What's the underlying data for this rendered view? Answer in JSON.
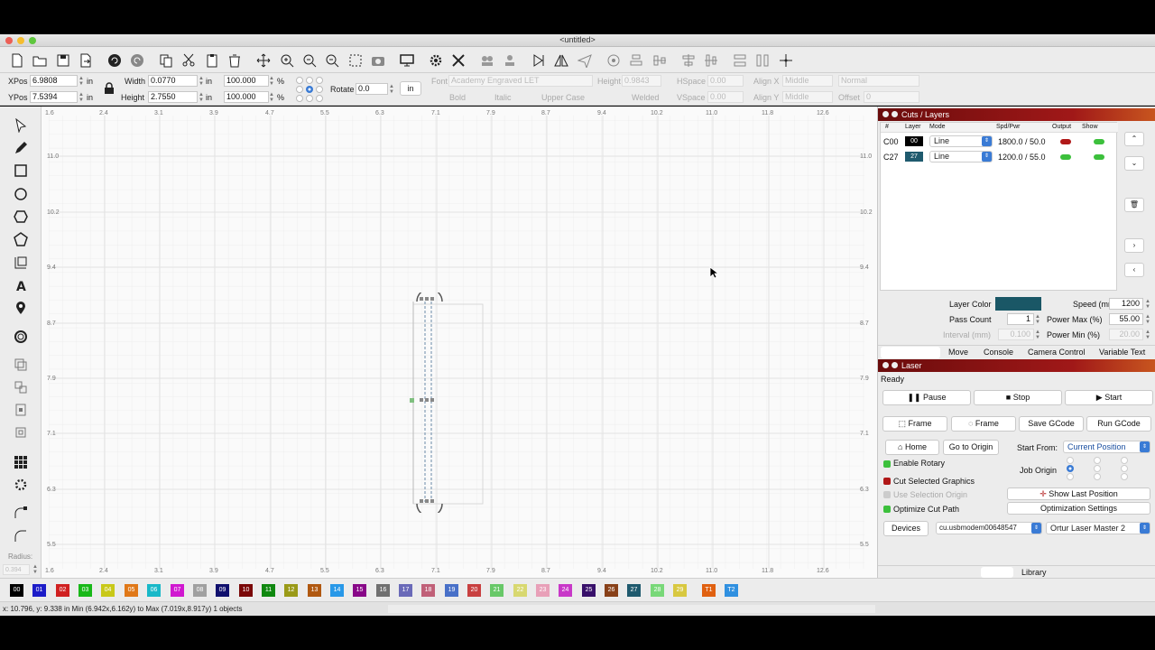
{
  "window": {
    "title": "<untitled>"
  },
  "props": {
    "xpos_label": "XPos",
    "xpos_value": "6.9808",
    "xpos_unit": "in",
    "ypos_label": "YPos",
    "ypos_value": "7.5394",
    "ypos_unit": "in",
    "width_label": "Width",
    "width_value": "0.0770",
    "width_unit": "in",
    "height_label": "Height",
    "height_value": "2.7550",
    "height_unit": "in",
    "scale_x": "100.000",
    "scale_y": "100.000",
    "pct": "%",
    "rotate_label": "Rotate",
    "rotate_value": "0.0",
    "units_button": "in",
    "font_label": "Font",
    "font_value": "Academy Engraved LET",
    "text_height_label": "Height",
    "text_height_value": "0.9843",
    "hspace_label": "HSpace",
    "hspace_value": "0.00",
    "vspace_label": "VSpace",
    "vspace_value": "0.00",
    "alignx_label": "Align X",
    "alignx_value": "Middle",
    "aligny_label": "Align Y",
    "aligny_value": "Middle",
    "style_value": "Normal",
    "offset_label": "Offset",
    "offset_value": "0",
    "bold": "Bold",
    "italic": "Italic",
    "upper_case": "Upper Case",
    "welded": "Welded"
  },
  "ruler": {
    "top": [
      "1.6",
      "2.4",
      "3.1",
      "3.9",
      "4.7",
      "5.5",
      "6.3",
      "7.1",
      "7.9",
      "8.7",
      "9.4",
      "10.2",
      "11.0",
      "11.8",
      "12.6"
    ],
    "bottom": [
      "1.6",
      "2.4",
      "3.1",
      "3.9",
      "4.7",
      "5.5",
      "6.3",
      "7.1",
      "7.9",
      "8.7",
      "9.4",
      "10.2",
      "11.0",
      "11.8",
      "12.6"
    ],
    "left": [
      "11.0",
      "10.2",
      "9.4",
      "8.7",
      "7.9",
      "7.1",
      "6.3",
      "5.5"
    ],
    "right": [
      "11.0",
      "10.2",
      "9.4",
      "8.7",
      "7.9",
      "7.1",
      "6.3",
      "5.5"
    ]
  },
  "left_tools": {
    "radius_label": "Radius:",
    "radius_value": "0.394"
  },
  "cuts": {
    "title": "Cuts / Layers",
    "headers": {
      "num": "#",
      "layer": "Layer",
      "mode": "Mode",
      "spdpwr": "Spd/Pwr",
      "output": "Output",
      "show": "Show"
    },
    "rows": [
      {
        "num": "C00",
        "layer": "00",
        "mode": "Line",
        "spdpwr": "1800.0 / 50.0",
        "color": "#000000"
      },
      {
        "num": "C27",
        "layer": "27",
        "mode": "Line",
        "spdpwr": "1200.0 / 55.0",
        "color": "#1f5a6e"
      }
    ],
    "layer_color_label": "Layer Color",
    "layer_color": "#1a5766",
    "speed_label": "Speed (mm/m)",
    "speed_value": "1200",
    "pass_count_label": "Pass Count",
    "pass_count_value": "1",
    "power_max_label": "Power Max (%)",
    "power_max_value": "55.00",
    "interval_label": "Interval (mm)",
    "interval_value": "0.100",
    "power_min_label": "Power Min (%)",
    "power_min_value": "20.00",
    "tabs": [
      "Move",
      "Console",
      "Camera Control",
      "Variable Text"
    ]
  },
  "laser": {
    "title": "Laser",
    "status": "Ready",
    "pause": "Pause",
    "stop": "Stop",
    "start": "Start",
    "frame1": "Frame",
    "frame2": "Frame",
    "save_gcode": "Save GCode",
    "run_gcode": "Run GCode",
    "home": "Home",
    "go_to_origin": "Go to Origin",
    "start_from_label": "Start From:",
    "start_from_value": "Current Position",
    "enable_rotary": "Enable Rotary",
    "job_origin": "Job Origin",
    "cut_selected": "Cut Selected Graphics",
    "use_selection_origin": "Use Selection Origin",
    "optimize_cut_path": "Optimize Cut Path",
    "show_last_position": "Show Last Position",
    "optimization_settings": "Optimization Settings",
    "devices": "Devices",
    "port": "cu.usbmodem00648547",
    "device": "Ortur Laser Master 2",
    "library": "Library"
  },
  "palette": [
    {
      "label": "00",
      "color": "#000000"
    },
    {
      "label": "01",
      "color": "#1c1cc8"
    },
    {
      "label": "02",
      "color": "#d02020"
    },
    {
      "label": "03",
      "color": "#18b818"
    },
    {
      "label": "04",
      "color": "#c8c818"
    },
    {
      "label": "05",
      "color": "#e07818"
    },
    {
      "label": "06",
      "color": "#18b8c8"
    },
    {
      "label": "07",
      "color": "#d018d0"
    },
    {
      "label": "08",
      "color": "#a0a0a0"
    },
    {
      "label": "09",
      "color": "#10106e"
    },
    {
      "label": "10",
      "color": "#7a0808"
    },
    {
      "label": "11",
      "color": "#108810"
    },
    {
      "label": "12",
      "color": "#9a9a18"
    },
    {
      "label": "13",
      "color": "#b05810"
    },
    {
      "label": "14",
      "color": "#2898e8"
    },
    {
      "label": "15",
      "color": "#880888"
    },
    {
      "label": "16",
      "color": "#707070"
    },
    {
      "label": "17",
      "color": "#6a6ab8"
    },
    {
      "label": "18",
      "color": "#c06078"
    },
    {
      "label": "19",
      "color": "#4870c8"
    },
    {
      "label": "20",
      "color": "#c84040"
    },
    {
      "label": "21",
      "color": "#68c868"
    },
    {
      "label": "22",
      "color": "#d8d870"
    },
    {
      "label": "23",
      "color": "#e8a0b8"
    },
    {
      "label": "24",
      "color": "#c838c8"
    },
    {
      "label": "25",
      "color": "#38106a"
    },
    {
      "label": "26",
      "color": "#884018"
    },
    {
      "label": "27",
      "color": "#1f5a6e"
    },
    {
      "label": "28",
      "color": "#78d878"
    },
    {
      "label": "29",
      "color": "#d8c840"
    },
    {
      "label": "T1",
      "color": "#e06010"
    },
    {
      "label": "T2",
      "color": "#3090e0"
    }
  ],
  "status": {
    "text": "x: 10.796, y: 9.338 in    Min (6.942x,6.162y) to Max (7.019x,8.917y)  1 objects"
  }
}
